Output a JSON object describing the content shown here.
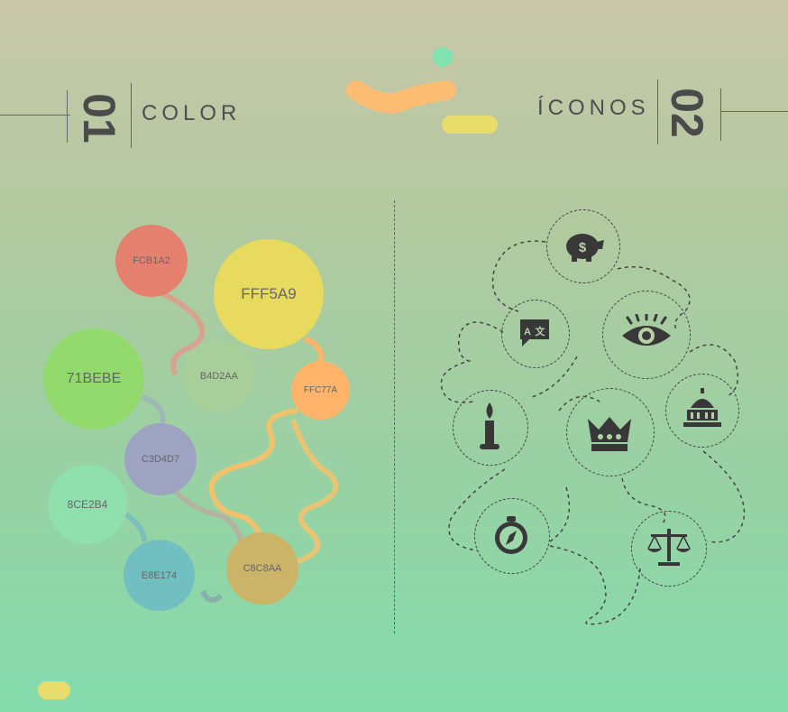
{
  "sections": {
    "left": {
      "number": "01",
      "title": "COLOR"
    },
    "right": {
      "number": "02",
      "title": "ÍCONOS"
    }
  },
  "colors": [
    {
      "hex": "FCB1A2",
      "fill": "#e5806e"
    },
    {
      "hex": "FFF5A9",
      "fill": "#e8da5f"
    },
    {
      "hex": "71BEBE",
      "fill": "#92da6e"
    },
    {
      "hex": "B4D2AA",
      "fill": "#a8cf9a"
    },
    {
      "hex": "FFC77A",
      "fill": "#ffb469"
    },
    {
      "hex": "C3D4D7",
      "fill": "#9ea3c2"
    },
    {
      "hex": "8CE2B4",
      "fill": "#8fe0ad"
    },
    {
      "hex": "E8E174",
      "fill": "#71bfc0"
    },
    {
      "hex": "C8C8AA",
      "fill": "#cbb468"
    }
  ],
  "icons": [
    "piggy-bank-icon",
    "translate-icon",
    "eye-icon",
    "candle-icon",
    "crown-icon",
    "capitol-icon",
    "compass-icon",
    "scales-icon"
  ]
}
